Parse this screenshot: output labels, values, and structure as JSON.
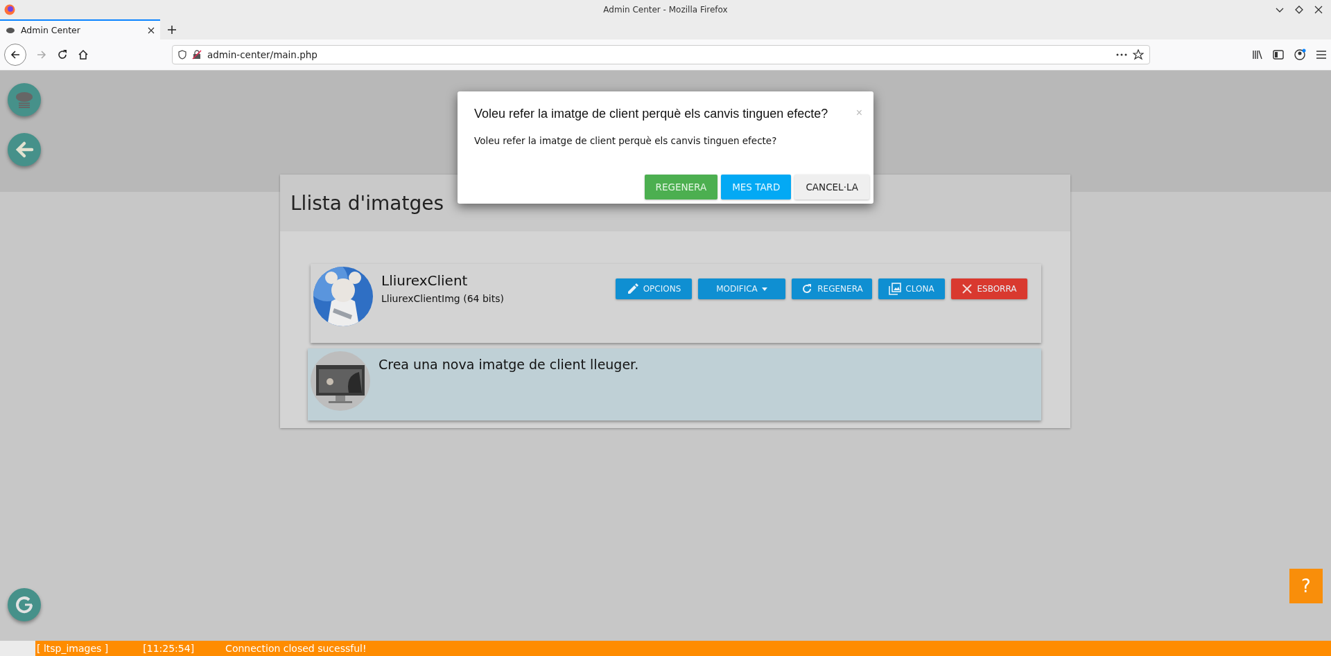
{
  "window": {
    "title": "Admin Center - Mozilla Firefox"
  },
  "tabs": [
    {
      "label": "Admin Center",
      "selected": true
    }
  ],
  "address_bar": {
    "url": "admin-center/main.php"
  },
  "card": {
    "title": "Llista d'imatges",
    "images": [
      {
        "name": "LliurexClient",
        "subtitle": "LliurexClientImg (64 bits)",
        "actions": [
          {
            "kind": "edit",
            "label": "OPCIONS"
          },
          {
            "kind": "menu",
            "label": "MODIFICA"
          },
          {
            "kind": "refresh",
            "label": "REGENERA"
          },
          {
            "kind": "clone",
            "label": "CLONA"
          },
          {
            "kind": "delete",
            "label": "ESBORRA"
          }
        ]
      },
      {
        "kind": "new",
        "name": "Crea una nova imatge de client lleuger."
      }
    ]
  },
  "dialog": {
    "title": "Voleu refer la imatge de client perquè els canvis tinguen efecte?",
    "message": "Voleu refer la imatge de client perquè els canvis tinguen efecte?",
    "close": "×",
    "buttons": [
      {
        "kind": "success",
        "label": "REGENERA"
      },
      {
        "kind": "info",
        "label": "MES TARD"
      },
      {
        "kind": "default",
        "label": "CANCEL·LA"
      }
    ]
  },
  "help": {
    "label": "?"
  },
  "status_bar": [
    {
      "text": "[ ltsp_images ]"
    },
    {
      "text": "[11:25:54]"
    },
    {
      "text": "Connection closed sucessful!"
    }
  ]
}
